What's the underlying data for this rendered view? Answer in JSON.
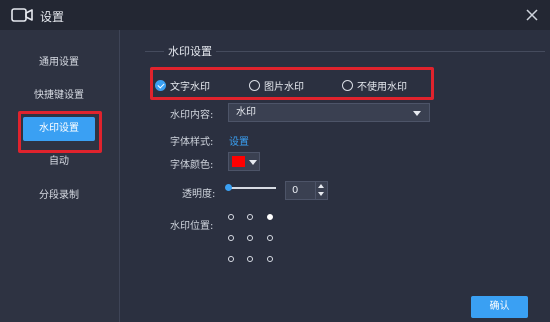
{
  "window": {
    "title": "设置",
    "accent": "#3aa0f3",
    "highlight": "#e0232d"
  },
  "sidebar": {
    "items": [
      {
        "label": "通用设置"
      },
      {
        "label": "快捷键设置"
      },
      {
        "label": "水印设置",
        "active": true
      },
      {
        "label": "自动"
      },
      {
        "label": "分段录制"
      }
    ]
  },
  "watermark": {
    "group_title": "水印设置",
    "type_options": [
      {
        "label": "文字水印",
        "selected": true
      },
      {
        "label": "图片水印",
        "selected": false
      },
      {
        "label": "不使用水印",
        "selected": false
      }
    ],
    "content_label": "水印内容:",
    "content_value": "水印",
    "style_label": "字体样式:",
    "style_link": "设置",
    "color_label": "字体颜色:",
    "color_value": "#ff0000",
    "opacity_label": "透明度:",
    "opacity_value": "0",
    "position_label": "水印位置:",
    "position_selected": "top-right"
  },
  "footer": {
    "ok_label": "确认"
  }
}
